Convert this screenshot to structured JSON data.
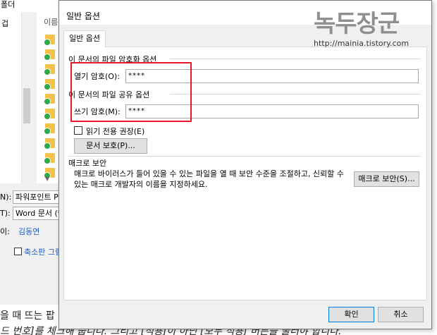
{
  "background": {
    "title_fragment": "폴더",
    "left_pane_text": "겁",
    "list_header": "이름",
    "fields": {
      "title_label": "N):",
      "title_value": "파워포인트 P",
      "type_label": "T):",
      "type_value": "Word 문서 (*",
      "author_label": "이:",
      "author_value": "김동연"
    },
    "checkbox_label": "축소판 그림",
    "bottom_line1": "을 때 뜨는 팝",
    "bottom_line2": "드 번호]를 체크해 줍니다. 그리고 [적용]이 아닌 [모두 적용] 버튼을 눌러야 합니다."
  },
  "dialog": {
    "title": "일반 옵션",
    "tab": "일반 옵션",
    "encrypt_section": "이 문서의 파일 암호화 옵션",
    "open_pw_label": "열기 암호(O):",
    "open_pw_value": "****",
    "share_section": "이 문서의 파일 공유 옵션",
    "write_pw_label": "쓰기 암호(M):",
    "write_pw_value": "****",
    "readonly_label": "읽기 전용 권장(E)",
    "protect_button": "문서 보호(P)...",
    "macro_section": "매크로 보안",
    "macro_desc": "매크로 바이러스가 들어 있을 수 있는 파일을 열 때 보안 수준을 조절하고, 신뢰할 수 있는 매크로 개발자의 이름을 지정하세요.",
    "macro_button": "매크로 보안(S)...",
    "ok_button": "확인",
    "cancel_button": "취소"
  },
  "watermark": {
    "logo_text": "녹두장군",
    "url": "http://mainia.tistory.com"
  },
  "colors": {
    "highlight": "#e8162b",
    "link_blue": "#1a5cc7",
    "dialog_bg": "#f0f0f0",
    "primary_button_border": "#0078d7"
  }
}
